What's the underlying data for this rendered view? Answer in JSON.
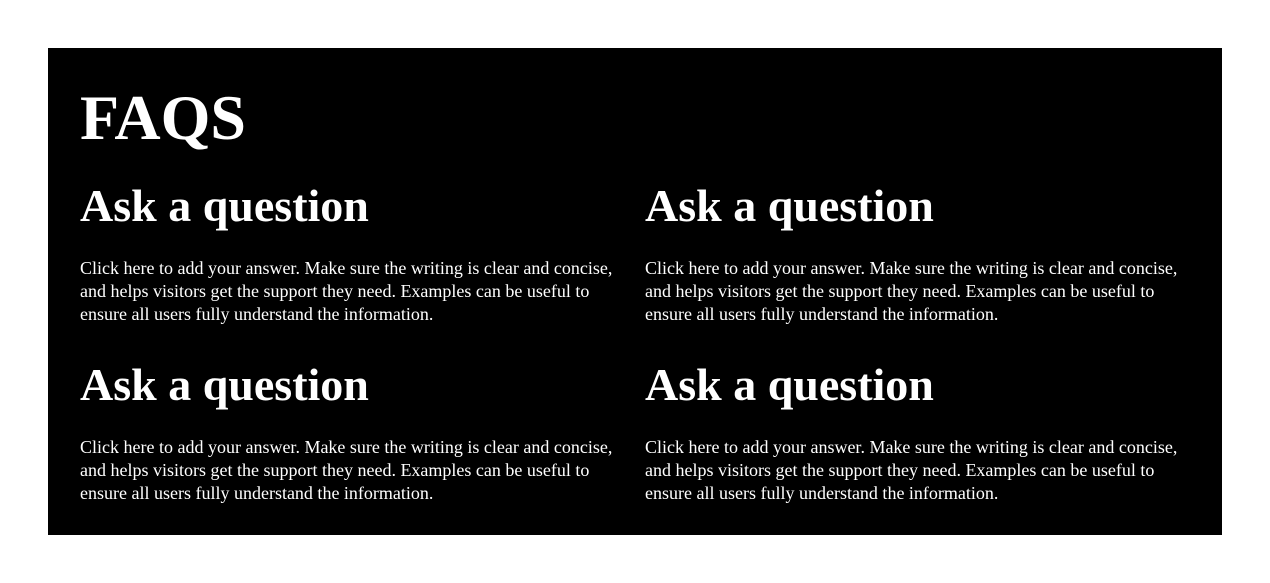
{
  "faq": {
    "title": "FAQS",
    "items": [
      {
        "question": "Ask a question",
        "answer": "Click here to add your answer. Make sure the writing is clear and concise, and helps visitors get the support they need. Examples can be useful to ensure all users fully understand the information."
      },
      {
        "question": "Ask a question",
        "answer": "Click here to add your answer. Make sure the writing is clear and concise, and helps visitors get the support they need. Examples can be useful to ensure all users fully understand the information."
      },
      {
        "question": "Ask a question",
        "answer": "Click here to add your answer. Make sure the writing is clear and concise, and helps visitors get the support they need. Examples can be useful to ensure all users fully understand the information."
      },
      {
        "question": "Ask a question",
        "answer": "Click here to add your answer. Make sure the writing is clear and concise, and helps visitors get the support they need. Examples can be useful to ensure all users fully understand the information."
      }
    ],
    "colors": {
      "background": "#000000",
      "text": "#ffffff",
      "page": "#ffffff"
    }
  }
}
